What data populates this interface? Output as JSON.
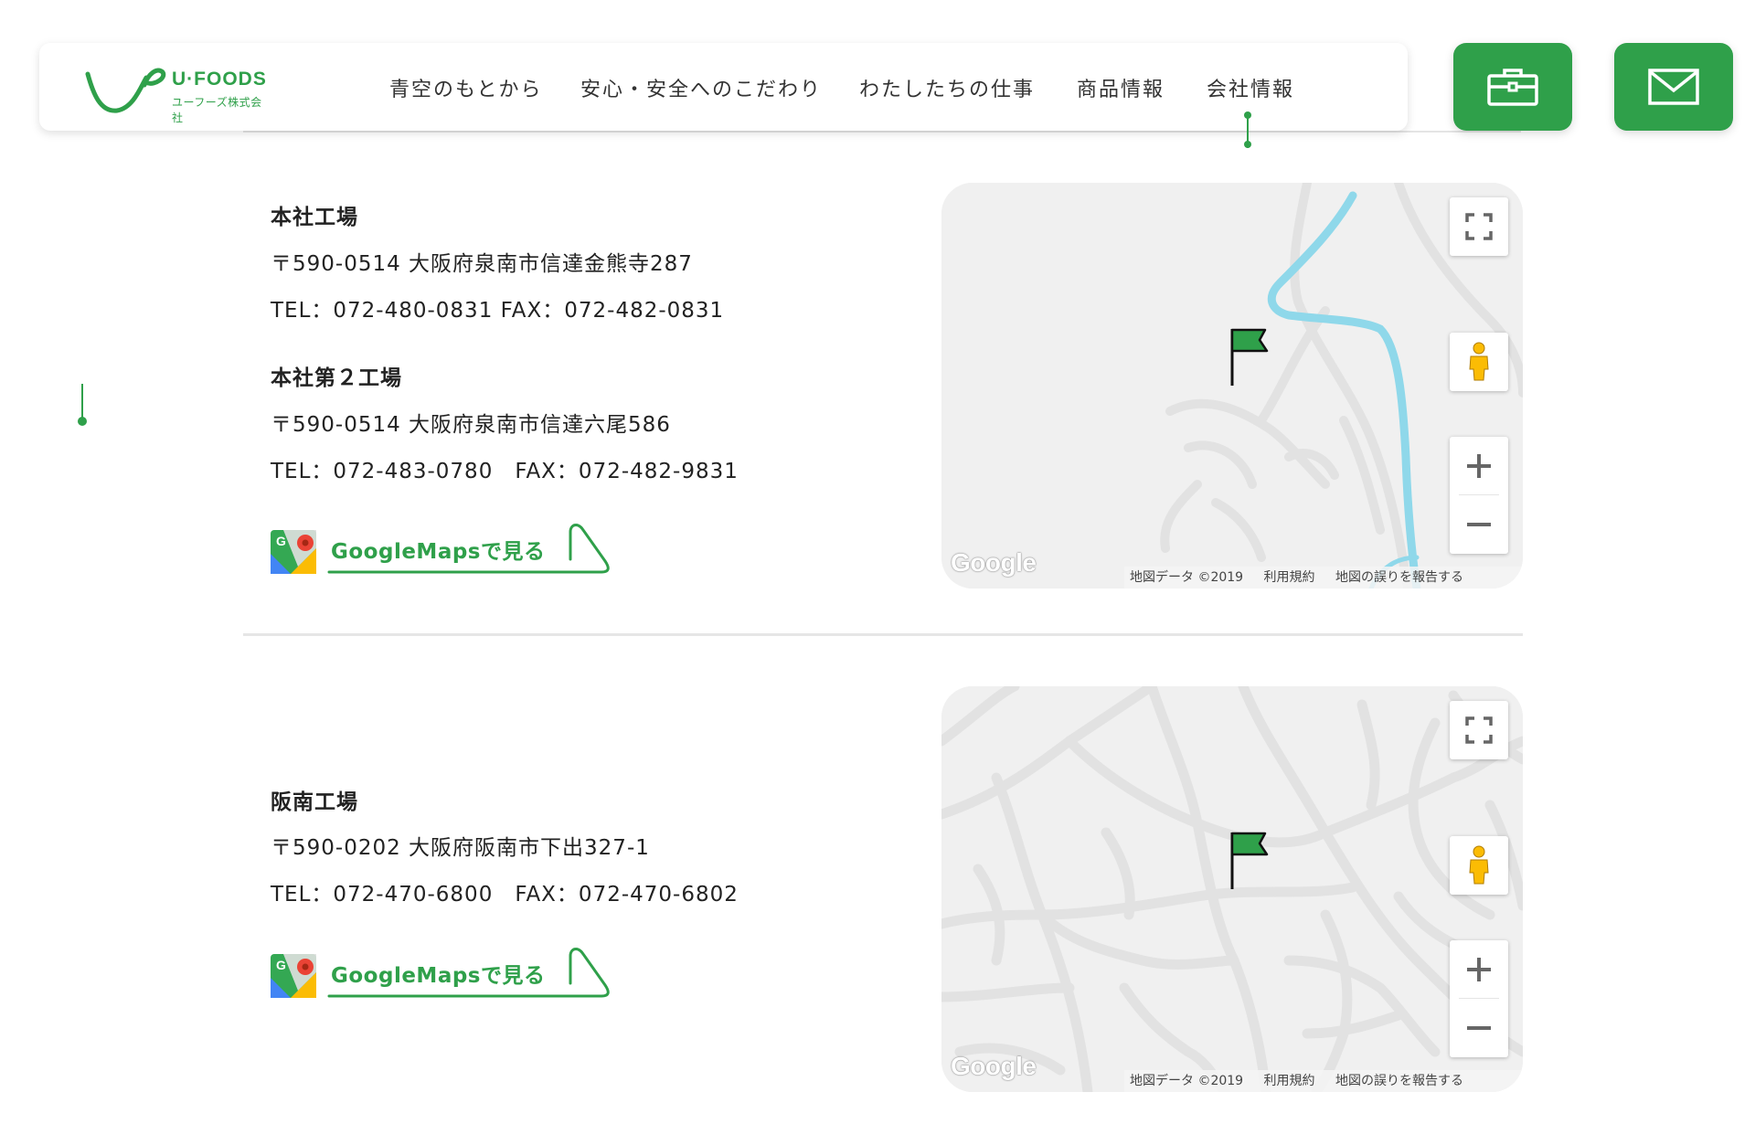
{
  "header": {
    "logo_text": "U·FOODS",
    "logo_subtitle": "ユーフーズ株式会社",
    "nav": [
      {
        "label": "青空のもとから"
      },
      {
        "label": "安心・安全へのこだわり"
      },
      {
        "label": "わたしたちの仕事"
      },
      {
        "label": "商品情報"
      },
      {
        "label": "会社情報"
      }
    ],
    "active_nav": "会社情報",
    "buttons": [
      {
        "icon": "briefcase-icon"
      },
      {
        "icon": "mail-icon"
      }
    ]
  },
  "factories": [
    {
      "name": "本社工場",
      "address": "〒590-0514 大阪府泉南市信達金熊寺287",
      "tel_fax": "TEL：072-480-0831 FAX：072-482-0831"
    },
    {
      "name": "本社第２工場",
      "address": "〒590-0514 大阪府泉南市信達六尾586",
      "tel_fax": "TEL：072-483-0780　FAX：072-482-9831"
    },
    {
      "name": "阪南工場",
      "address": "〒590-0202 大阪府阪南市下出327-1",
      "tel_fax": "TEL：072-470-6800　FAX：072-470-6802"
    }
  ],
  "map_links": [
    {
      "label": "GoogleMapsで見る"
    },
    {
      "label": "GoogleMapsで見る"
    }
  ],
  "maps": [
    {
      "logo": "Google",
      "attribution": {
        "data": "地図データ ©2019",
        "terms": "利用規約",
        "report": "地図の誤りを報告する"
      }
    },
    {
      "logo": "Google",
      "attribution": {
        "data": "地図データ ©2019",
        "terms": "利用規約",
        "report": "地図の誤りを報告する"
      }
    }
  ],
  "colors": {
    "brand_green": "#2fa04a",
    "river_blue": "#8fd8ea",
    "map_bg": "#f0f0f0"
  }
}
